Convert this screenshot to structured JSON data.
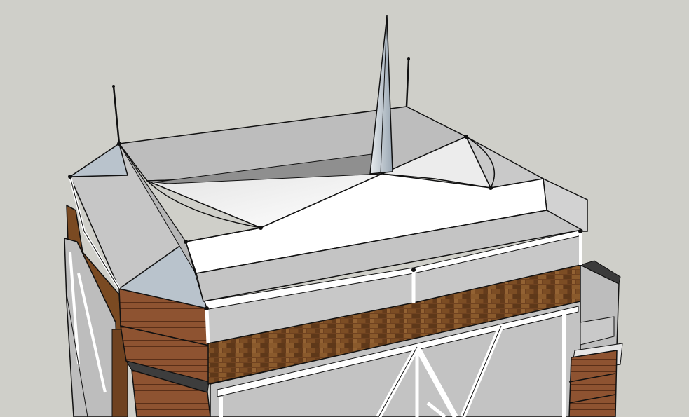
{
  "scene": {
    "background": "#cfcfc9",
    "roof_light": "#ffffff",
    "roof_mid": "#c9c9c9",
    "roof_dark": "#8a8a8a",
    "panel_blue": "#b9c3cc",
    "brick": "#7a4a22",
    "siding": "#8b4f2e",
    "glass": "#b5b5b5",
    "outline": "#111111"
  }
}
